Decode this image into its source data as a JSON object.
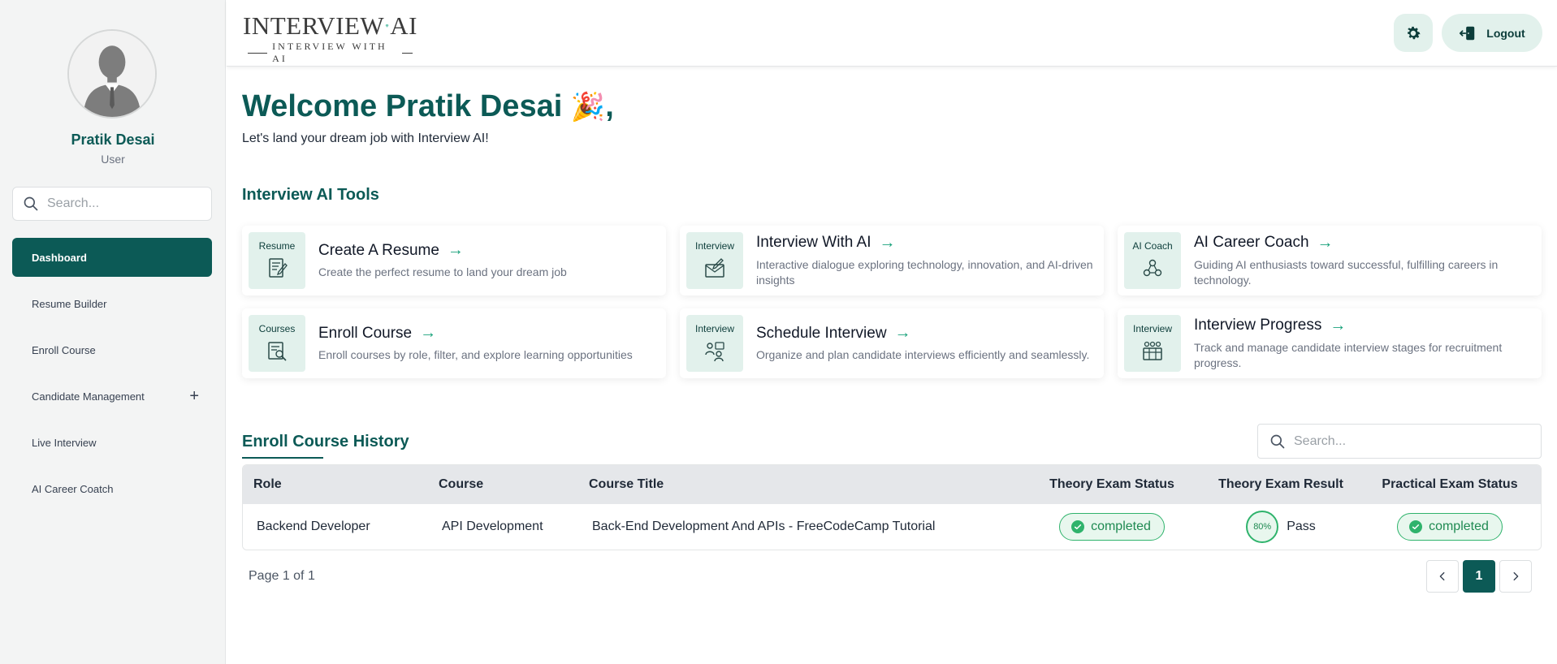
{
  "user": {
    "name": "Pratik Desai",
    "role": "User"
  },
  "sidebar": {
    "search_placeholder": "Search...",
    "items": [
      {
        "label": "Dashboard",
        "active": true
      },
      {
        "label": "Resume Builder"
      },
      {
        "label": "Enroll Course"
      },
      {
        "label": "Candidate Management",
        "expandable": true,
        "expand_symbol": "+"
      },
      {
        "label": "Live Interview"
      },
      {
        "label": "AI Career Coatch"
      }
    ]
  },
  "header": {
    "logo": {
      "left": "INTERVIEW",
      "right": "AI",
      "tagline": "INTERVIEW WITH AI"
    },
    "logout_label": "Logout",
    "icons": {
      "settings": "gear-icon",
      "logout": "logout-icon"
    }
  },
  "welcome": {
    "title": "Welcome Pratik Desai",
    "emoji": "🎉",
    "comma": ",",
    "subtitle": "Let's land your dream job with Interview AI!"
  },
  "tools": {
    "title": "Interview AI Tools",
    "cards": [
      {
        "tag": "Resume",
        "title": "Create A Resume",
        "desc": "Create the perfect resume to land your dream job"
      },
      {
        "tag": "Interview",
        "title": "Interview With AI",
        "desc": "Interactive dialogue exploring technology, innovation, and AI-driven insights"
      },
      {
        "tag": "AI Coach",
        "title": "AI Career Coach",
        "desc": "Guiding AI enthusiasts toward successful, fulfilling careers in technology."
      },
      {
        "tag": "Courses",
        "title": "Enroll Course",
        "desc": "Enroll courses by role, filter, and explore learning opportunities"
      },
      {
        "tag": "Interview",
        "title": "Schedule Interview",
        "desc": "Organize and plan candidate interviews efficiently and seamlessly."
      },
      {
        "tag": "Interview",
        "title": "Interview Progress",
        "desc": "Track and manage candidate interview stages for recruitment progress."
      }
    ],
    "arrow": "→"
  },
  "history": {
    "title": "Enroll Course History",
    "search_placeholder": "Search...",
    "columns": [
      "Role",
      "Course",
      "Course Title",
      "Theory Exam Status",
      "Theory Exam Result",
      "Practical Exam Status"
    ],
    "rows": [
      {
        "role": "Backend Developer",
        "course": "API Development",
        "course_title": "Back-End Development And APIs - FreeCodeCamp Tutorial",
        "theory_status": "completed",
        "theory_score": "80%",
        "theory_result": "Pass",
        "practical_status": "completed"
      }
    ],
    "page_info": "Page 1 of 1",
    "current_page": "1"
  },
  "colors": {
    "brand": "#0c5a56",
    "accent": "#19a27b",
    "success": "#2fb36c",
    "icon_bg": "#e2f1ec"
  }
}
